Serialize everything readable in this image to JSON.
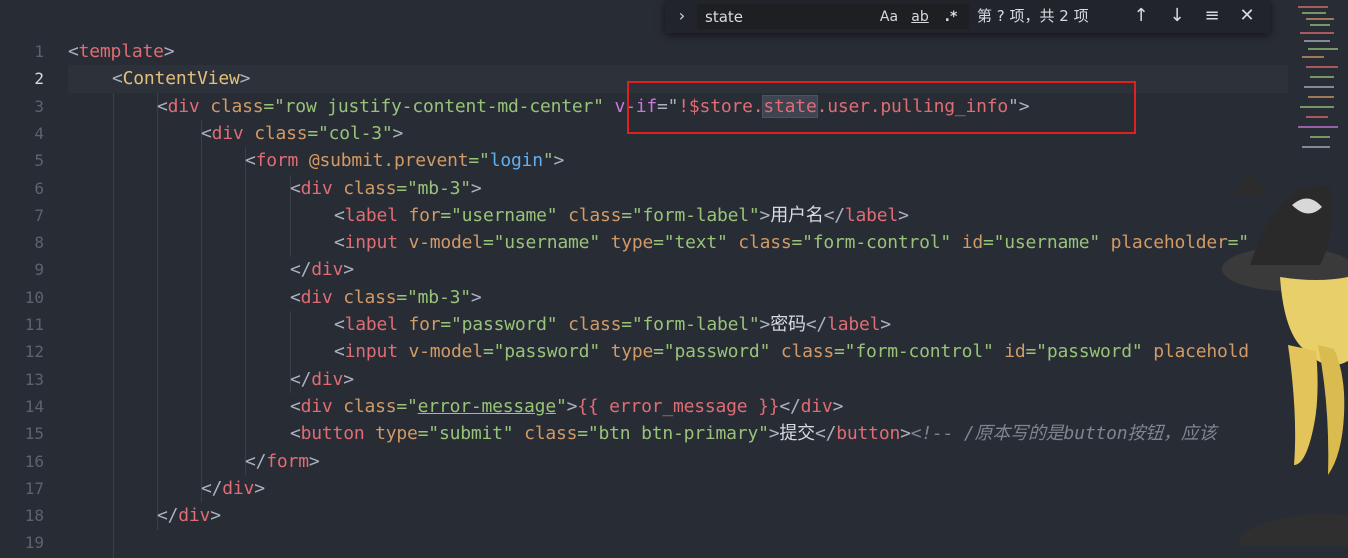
{
  "editor": {
    "line_numbers": [
      "1",
      "2",
      "3",
      "4",
      "5",
      "6",
      "7",
      "8",
      "9",
      "10",
      "11",
      "12",
      "13",
      "14",
      "15",
      "16",
      "17",
      "18",
      "19"
    ],
    "active_line": "2"
  },
  "code": {
    "l1": {
      "lt": "<",
      "tag": "template",
      "gt": ">"
    },
    "l2": {
      "lt": "<",
      "comp": "ContentView",
      "gt": ">"
    },
    "l3": {
      "lt": "<",
      "tag": "div",
      "sp": " ",
      "attr": "class",
      "eq": "=\"",
      "val": "row justify-content-md-center",
      "q": "\"",
      "sp2": " ",
      "dir": "v-if",
      "eq2": "=\"",
      "expr_a": "!$store.",
      "expr_match": "state",
      "expr_b": ".user.pulling_info",
      "q2": "\"",
      "gt": ">"
    },
    "l4": {
      "lt": "<",
      "tag": "div",
      "sp": " ",
      "attr": "class",
      "eq": "=\"",
      "val": "col-3",
      "q": "\"",
      "gt": ">"
    },
    "l5": {
      "lt": "<",
      "tag": "form",
      "sp": " ",
      "dir": "@submit.prevent",
      "eq": "=\"",
      "val": "login",
      "q": "\"",
      "gt": ">"
    },
    "l6": {
      "lt": "<",
      "tag": "div",
      "sp": " ",
      "attr": "class",
      "eq": "=\"",
      "val": "mb-3",
      "q": "\"",
      "gt": ">"
    },
    "l7": {
      "lt": "<",
      "tag": "label",
      "sp": " ",
      "attr": "for",
      "eq": "=\"",
      "val": "username",
      "q": "\"",
      "sp2": " ",
      "attr2": "class",
      "eq2": "=\"",
      "val2": "form-label",
      "q2": "\"",
      "gt": ">",
      "text": "用户名",
      "close_lt": "</",
      "close_tag": "label",
      "close_gt": ">"
    },
    "l8": {
      "lt": "<",
      "tag": "input",
      "sp": " ",
      "dir": "v-model",
      "eq": "=\"",
      "val": "username",
      "q": "\"",
      "sp2": " ",
      "attr2": "type",
      "eq2": "=\"",
      "val2": "text",
      "q2": "\"",
      "sp3": " ",
      "attr3": "class",
      "eq3": "=\"",
      "val3": "form-control",
      "q3": "\"",
      "sp4": " ",
      "attr4": "id",
      "eq4": "=\"",
      "val4": "username",
      "q4": "\"",
      "sp5": " ",
      "attr5": "placeholder",
      "eq5": "=\""
    },
    "l9": {
      "lt": "</",
      "tag": "div",
      "gt": ">"
    },
    "l10": {
      "lt": "<",
      "tag": "div",
      "sp": " ",
      "attr": "class",
      "eq": "=\"",
      "val": "mb-3",
      "q": "\"",
      "gt": ">"
    },
    "l11": {
      "lt": "<",
      "tag": "label",
      "sp": " ",
      "attr": "for",
      "eq": "=\"",
      "val": "password",
      "q": "\"",
      "sp2": " ",
      "attr2": "class",
      "eq2": "=\"",
      "val2": "form-label",
      "q2": "\"",
      "gt": ">",
      "text": "密码",
      "close_lt": "</",
      "close_tag": "label",
      "close_gt": ">"
    },
    "l12": {
      "lt": "<",
      "tag": "input",
      "sp": " ",
      "dir": "v-model",
      "eq": "=\"",
      "val": "password",
      "q": "\"",
      "sp2": " ",
      "attr2": "type",
      "eq2": "=\"",
      "val2": "password",
      "q2": "\"",
      "sp3": " ",
      "attr3": "class",
      "eq3": "=\"",
      "val3": "form-control",
      "q3": "\"",
      "sp4": " ",
      "attr4": "id",
      "eq4": "=\"",
      "val4": "password",
      "q4": "\"",
      "sp5": " ",
      "attr5": "placehold"
    },
    "l13": {
      "lt": "</",
      "tag": "div",
      "gt": ">"
    },
    "l14": {
      "lt": "<",
      "tag": "div",
      "sp": " ",
      "attr": "class",
      "eq": "=\"",
      "val": "error-message",
      "q": "\"",
      "gt": ">",
      "mustache_open": "{{ ",
      "expr": "error_message",
      "mustache_close": " }}",
      "close_lt": "</",
      "close_tag": "div",
      "close_gt": ">"
    },
    "l15": {
      "lt": "<",
      "tag": "button",
      "sp": " ",
      "attr": "type",
      "eq": "=\"",
      "val": "submit",
      "q": "\"",
      "sp2": " ",
      "attr2": "class",
      "eq2": "=\"",
      "val2": "btn btn-primary",
      "q2": "\"",
      "gt": ">",
      "text": "提交",
      "close_lt": "</",
      "close_tag": "button",
      "close_gt": ">",
      "comment": "<!-- /原本写的是button按钮，应该"
    },
    "l16": {
      "lt": "</",
      "tag": "form",
      "gt": ">"
    },
    "l17": {
      "lt": "</",
      "tag": "div",
      "gt": ">"
    },
    "l18": {
      "lt": "</",
      "tag": "div",
      "gt": ">"
    }
  },
  "find": {
    "toggle_icon": "chevron-right-icon",
    "toggle_glyph": "›",
    "query": "state",
    "match_case_label": "Aa",
    "whole_word_label": "ab",
    "regex_label": ".*",
    "result_text": "第 ? 项，共 2 项",
    "prev_glyph": "↑",
    "next_glyph": "↓",
    "selection_glyph": "≡",
    "close_glyph": "✕"
  },
  "colors": {
    "background": "#282c34",
    "current_line": "#2c313a",
    "annotation_box": "#e02020",
    "tag": "#e06c75",
    "component": "#e5c07b",
    "attribute": "#d19a66",
    "string": "#98c379"
  }
}
